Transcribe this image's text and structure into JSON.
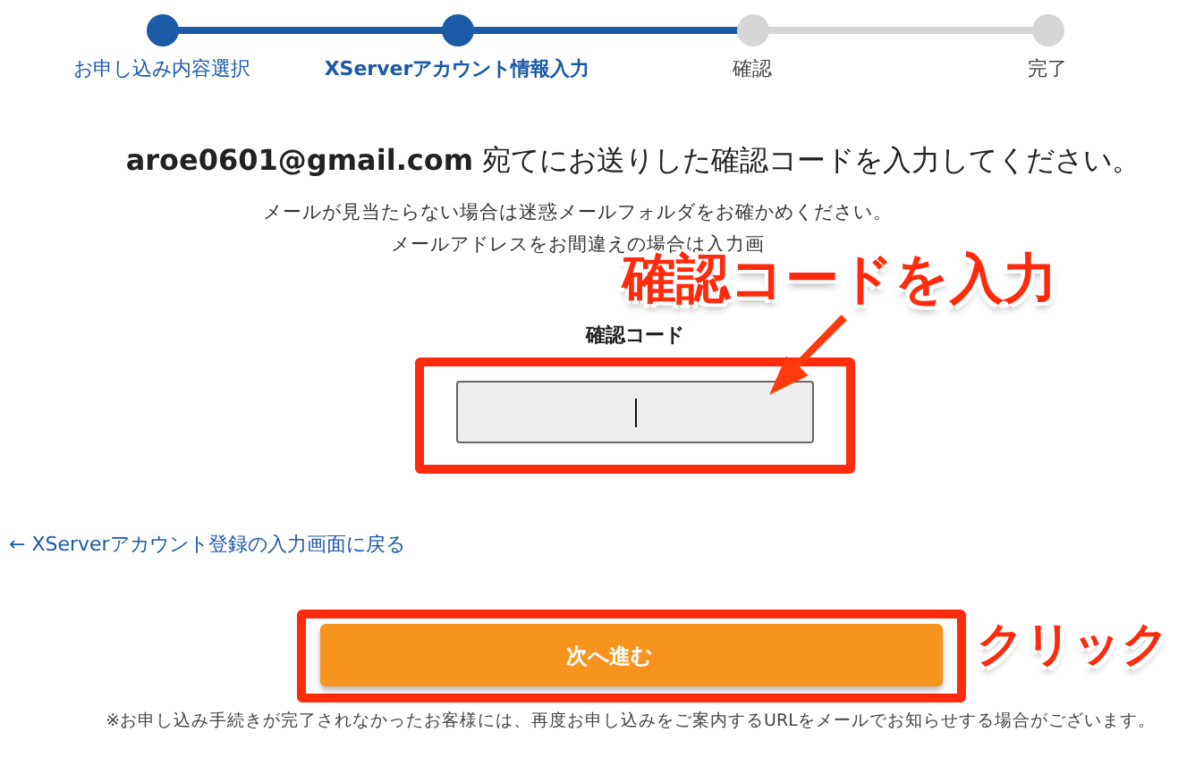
{
  "steps": [
    {
      "label": "お申し込み内容選択",
      "completed": true,
      "selected": false
    },
    {
      "label": "XServerアカウント情報入力",
      "completed": true,
      "selected": true
    },
    {
      "label": "確認",
      "completed": false,
      "selected": false
    },
    {
      "label": "完了",
      "completed": false,
      "selected": false
    }
  ],
  "heading": "**aroe0601@gmail.com** 宛てにお送りした確認コードを入力してください。",
  "notes": [
    "メールが見当たらない場合は迷惑メールフォルダをお確かめください。",
    "メールアドレスをお間違えの場合は入力画"
  ],
  "code_field": {
    "label": "確認コード",
    "highlighted": true
  },
  "back_link": "← XServerアカウント登録の入力画面に戻る",
  "next_button": {
    "label": "次へ進む",
    "highlighted": true
  },
  "footnote": "※お申し込み手続きが完了されなかったお客様には、再度お申し込みをご案内するURLをメールでお知らせする場合がございます。",
  "annotations": [
    {
      "kind": "arrow-callout",
      "text": "確認コードを入力"
    },
    {
      "kind": "callout",
      "text": "クリック"
    }
  ]
}
